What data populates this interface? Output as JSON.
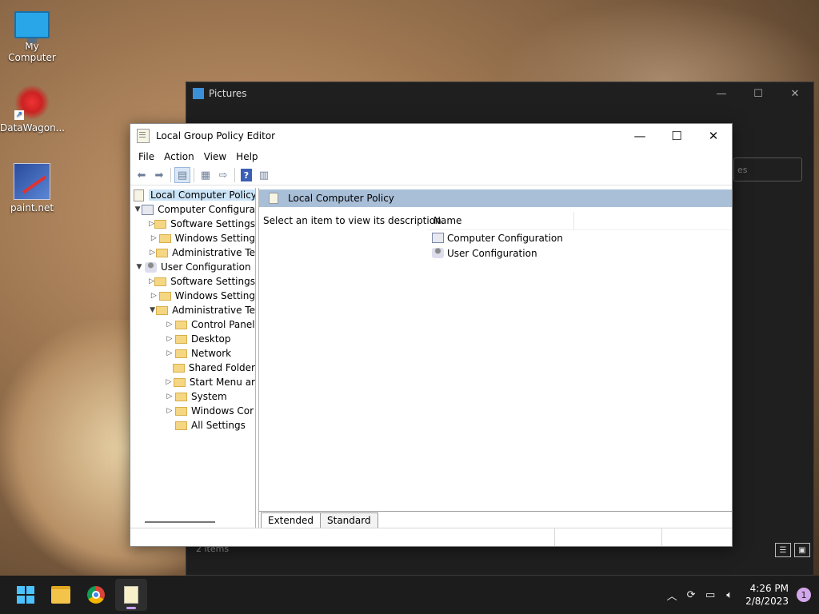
{
  "desktop": {
    "icons": [
      {
        "label": "My Computer"
      },
      {
        "label": "DataWagon..."
      },
      {
        "label": "paint.net"
      }
    ]
  },
  "pictures_window": {
    "title": "Pictures",
    "search_placeholder": "es",
    "status": "2 items"
  },
  "gpo": {
    "title": "Local Group Policy Editor",
    "menu": [
      "File",
      "Action",
      "View",
      "Help"
    ],
    "tree": {
      "root": "Local Computer Policy",
      "computer_config": "Computer Configura",
      "cc_software": "Software Settings",
      "cc_windows": "Windows Setting",
      "cc_admin": "Administrative Te",
      "user_config": "User Configuration",
      "uc_software": "Software Settings",
      "uc_windows": "Windows Setting",
      "uc_admin": "Administrative Te",
      "control_panel": "Control Panel",
      "desktop": "Desktop",
      "network": "Network",
      "shared_folders": "Shared Folder",
      "start_menu": "Start Menu ar",
      "system": "System",
      "windows_components": "Windows Cor",
      "all_settings": "All Settings"
    },
    "right_header": "Local Computer Policy",
    "description": "Select an item to view its description.",
    "list": {
      "column_name": "Name",
      "items": [
        "Computer Configuration",
        "User Configuration"
      ]
    },
    "tabs": [
      "Extended",
      "Standard"
    ]
  },
  "taskbar": {
    "time": "4:26 PM",
    "date": "2/8/2023",
    "notification_count": "1"
  }
}
